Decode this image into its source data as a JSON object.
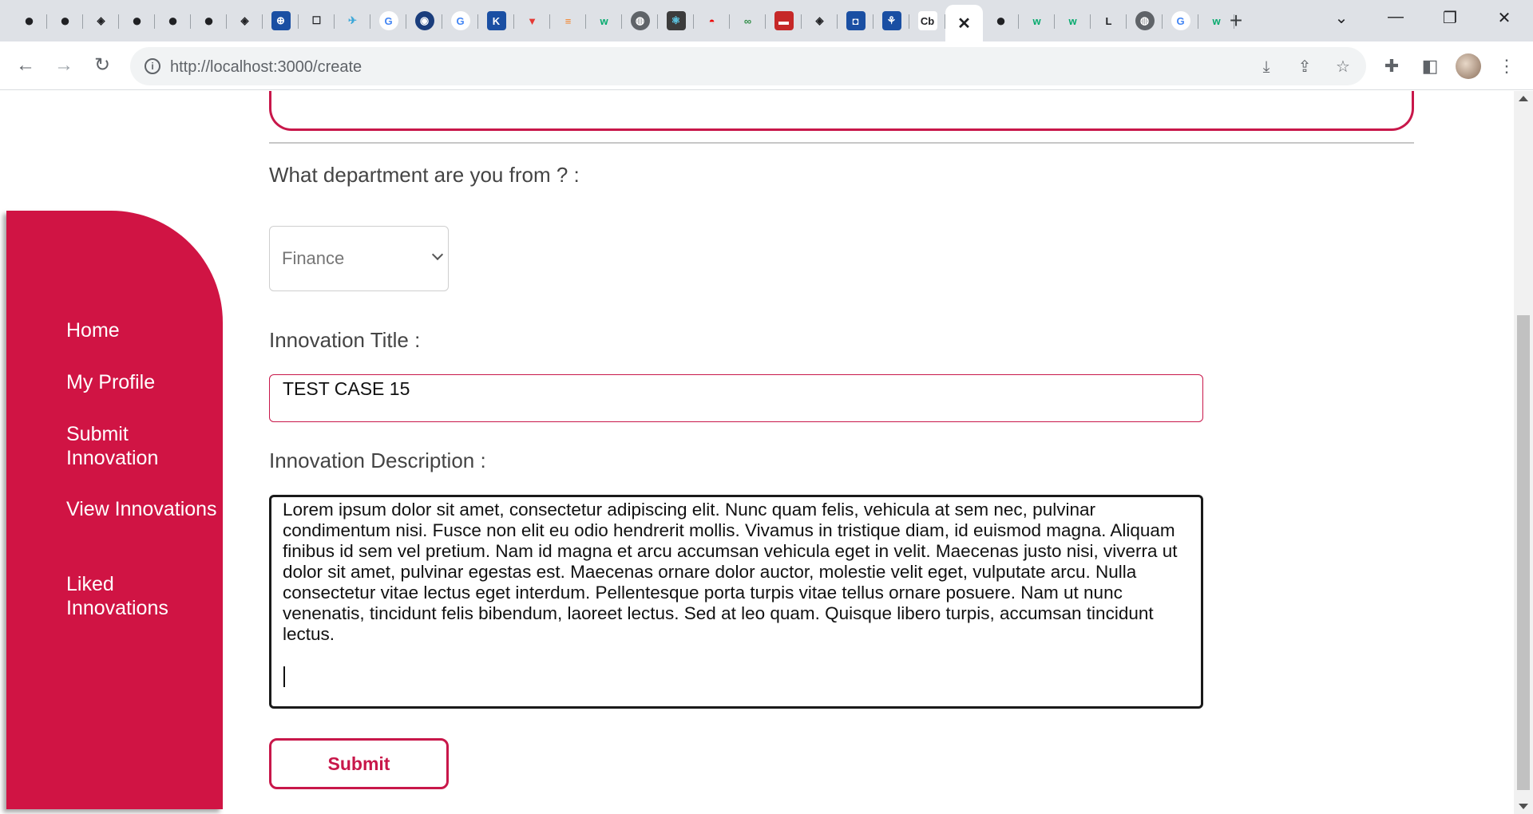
{
  "browser": {
    "tabs": [
      {
        "icon": "github-icon",
        "glyph": "●"
      },
      {
        "icon": "github-icon",
        "glyph": "●"
      },
      {
        "icon": "codepen-icon",
        "glyph": "◈"
      },
      {
        "icon": "github-icon",
        "glyph": "●"
      },
      {
        "icon": "github-icon",
        "glyph": "●"
      },
      {
        "icon": "github-icon",
        "glyph": "●"
      },
      {
        "icon": "codepen-icon",
        "glyph": "◈"
      },
      {
        "icon": "app-icon",
        "glyph": "⊕"
      },
      {
        "icon": "square-icon",
        "glyph": "☐"
      },
      {
        "icon": "bird-icon",
        "glyph": "✈"
      },
      {
        "icon": "google-icon",
        "glyph": "G"
      },
      {
        "icon": "lock-icon",
        "glyph": "◉"
      },
      {
        "icon": "google-icon",
        "glyph": "G"
      },
      {
        "icon": "app-icon",
        "glyph": "K"
      },
      {
        "icon": "vercel-icon",
        "glyph": "▼"
      },
      {
        "icon": "stackoverflow-icon",
        "glyph": "≡"
      },
      {
        "icon": "w3schools-icon",
        "glyph": "w"
      },
      {
        "icon": "globe-icon",
        "glyph": "◍"
      },
      {
        "icon": "react-icon",
        "glyph": "⚛"
      },
      {
        "icon": "redhat-icon",
        "glyph": "◓"
      },
      {
        "icon": "geeksforgeeks-icon",
        "glyph": "∞"
      },
      {
        "icon": "hud-icon",
        "glyph": "▬"
      },
      {
        "icon": "codepen-icon",
        "glyph": "◈"
      },
      {
        "icon": "app-icon",
        "glyph": "◘"
      },
      {
        "icon": "app-icon",
        "glyph": "⚘"
      },
      {
        "icon": "coinbase-icon",
        "glyph": "Cb"
      },
      {
        "icon": "close-icon",
        "glyph": "✕",
        "active": true
      },
      {
        "icon": "github-icon",
        "glyph": "●"
      },
      {
        "icon": "w3schools-icon",
        "glyph": "w"
      },
      {
        "icon": "w3schools-icon",
        "glyph": "w"
      },
      {
        "icon": "letter-l-icon",
        "glyph": "L"
      },
      {
        "icon": "globe-icon",
        "glyph": "◍"
      },
      {
        "icon": "google-icon",
        "glyph": "G"
      },
      {
        "icon": "w3schools-icon",
        "glyph": "w"
      }
    ],
    "new_tab": "+",
    "url": "http://localhost:3000/create"
  },
  "form": {
    "department_label": "What department are you from ? :",
    "department_value": "Finance",
    "title_label": "Innovation Title :",
    "title_value": "TEST CASE 15",
    "description_label": "Innovation Description :",
    "description_value": "Lorem ipsum dolor sit amet, consectetur adipiscing elit. Nunc quam felis, vehicula at sem nec, pulvinar condimentum nisi. Fusce non elit eu odio hendrerit mollis. Vivamus in tristique diam, id euismod magna. Aliquam finibus id sem vel pretium. Nam id magna et arcu accumsan vehicula eget in velit. Maecenas justo nisi, viverra ut dolor sit amet, pulvinar egestas est. Maecenas ornare dolor auctor, molestie velit eget, vulputate arcu. Nulla consectetur vitae lectus eget interdum. Pellentesque porta turpis vitae tellus ornare posuere. Nam ut nunc venenatis, tincidunt felis bibendum, laoreet lectus. Sed at leo quam. Quisque libero turpis, accumsan tincidunt lectus.",
    "submit_label": "Submit"
  },
  "sidebar": {
    "items": [
      {
        "label": "Home"
      },
      {
        "label": "My Profile"
      },
      {
        "label": "Submit Innovation"
      },
      {
        "label": "View Innovations"
      },
      {
        "label": "Liked Innovations"
      }
    ]
  },
  "colors": {
    "accent": "#d01444",
    "border_accent": "#c8174a"
  }
}
